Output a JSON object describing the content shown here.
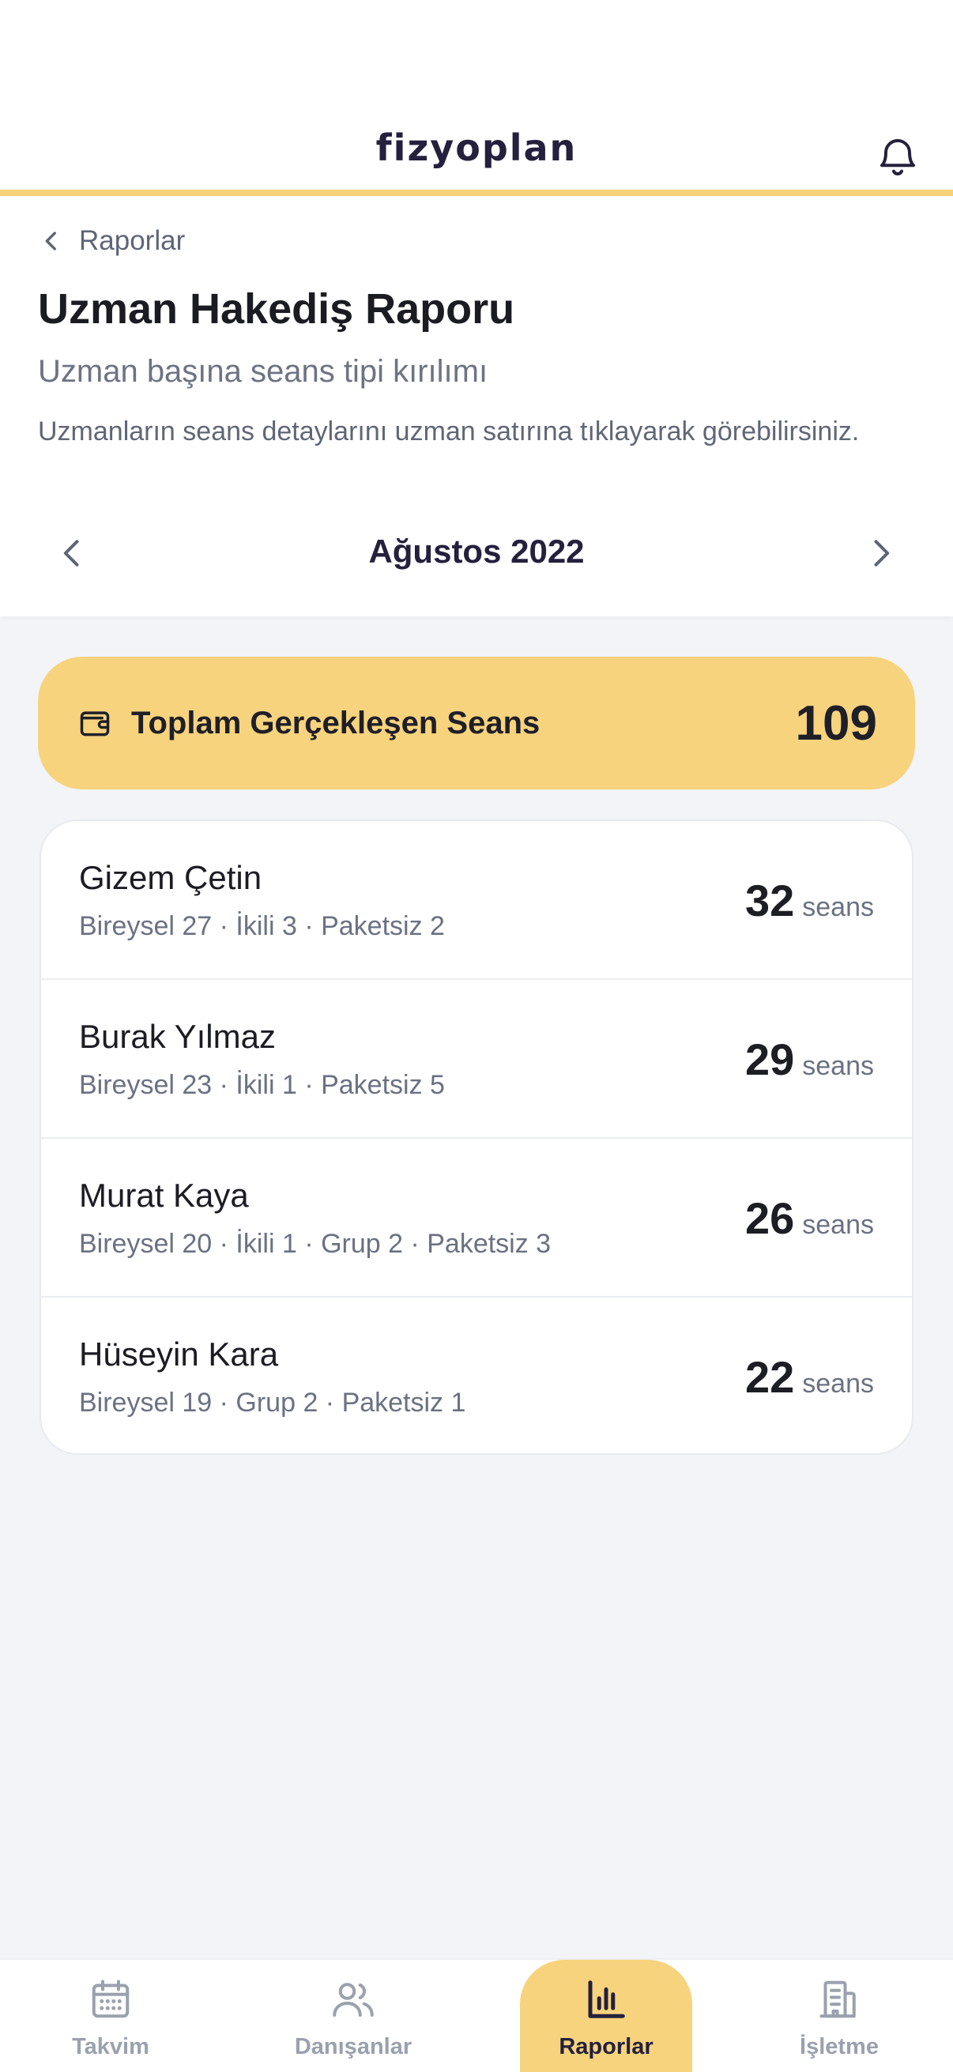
{
  "app": {
    "brand": "fizyoplan"
  },
  "header": {
    "back_label": "Raporlar",
    "title": "Uzman Hakediş Raporu",
    "subtitle": "Uzman başına seans tipi kırılımı",
    "description": "Uzmanların seans detaylarını uzman satırına tıklayarak görebilirsiniz.",
    "month": "Ağustos 2022"
  },
  "total": {
    "label": "Toplam Gerçekleşen Seans",
    "value": "109",
    "icon": "wallet-icon"
  },
  "experts": [
    {
      "name": "Gizem Çetin",
      "breakdown": "Bireysel 27 · İkili 3 · Paketsiz 2",
      "count": "32",
      "unit": "seans"
    },
    {
      "name": "Burak Yılmaz",
      "breakdown": "Bireysel 23 · İkili 1 · Paketsiz 5",
      "count": "29",
      "unit": "seans"
    },
    {
      "name": "Murat Kaya",
      "breakdown": "Bireysel 20 · İkili 1 · Grup 2 · Paketsiz 3",
      "count": "26",
      "unit": "seans"
    },
    {
      "name": "Hüseyin Kara",
      "breakdown": "Bireysel 19 · Grup 2 · Paketsiz 1",
      "count": "22",
      "unit": "seans"
    }
  ],
  "nav": {
    "items": [
      {
        "label": "Takvim",
        "icon": "calendar-icon"
      },
      {
        "label": "Danışanlar",
        "icon": "users-icon"
      },
      {
        "label": "Raporlar",
        "icon": "bar-chart-icon",
        "active": true
      },
      {
        "label": "İşletme",
        "icon": "building-icon"
      }
    ]
  },
  "colors": {
    "accent": "#f7d37d",
    "brand_text": "#24203d",
    "background": "#f3f4f7"
  }
}
